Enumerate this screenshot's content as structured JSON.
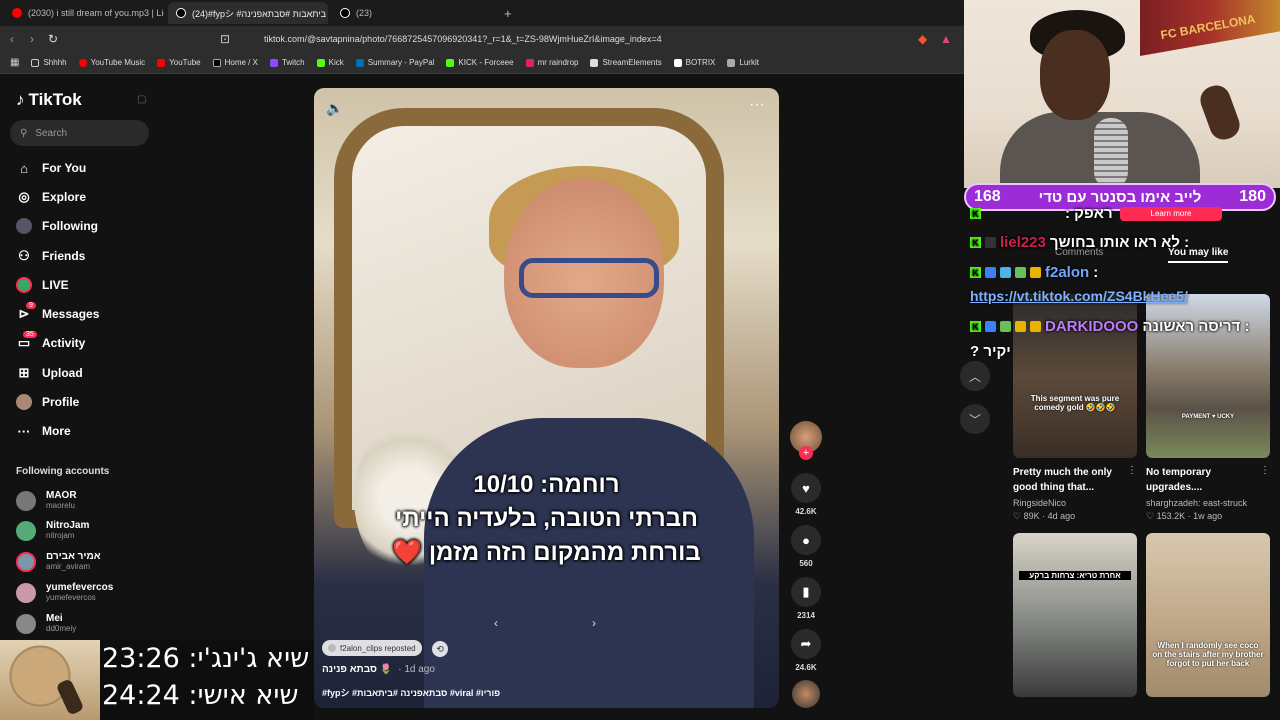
{
  "browser": {
    "tabs": [
      {
        "title": "(2030) i still dream of you.mp3 | Liqu",
        "active": false,
        "color": "#ff0000"
      },
      {
        "title": "(24)#fypシ #ביתאבות #סבתאפנינה",
        "active": true,
        "color": "#ffffff"
      },
      {
        "title": "(23)",
        "active": false,
        "color": "#ffffff"
      }
    ],
    "new_tab": "+",
    "url": "tiktok.com/@savtapnina/photo/7668725457096920341?_r=1&_t=ZS-98WjmHueZrI&image_index=4",
    "bookmarks": [
      "Shhhh",
      "YouTube Music",
      "YouTube",
      "Home / X",
      "Twitch",
      "Kick",
      "Summary - PayPal",
      "KICK - Forceee",
      "mr raindrop",
      "StreamElements",
      "BOTRIX",
      "Lurkit"
    ]
  },
  "tiktok": {
    "logo": "TikTok",
    "search_placeholder": "Search",
    "nav": [
      {
        "label": "For You",
        "icon": "home-icon"
      },
      {
        "label": "Explore",
        "icon": "compass-icon"
      },
      {
        "label": "Following",
        "icon": "following-icon"
      },
      {
        "label": "Friends",
        "icon": "friends-icon"
      },
      {
        "label": "LIVE",
        "icon": "live-icon"
      },
      {
        "label": "Messages",
        "icon": "messages-icon",
        "badge": "9"
      },
      {
        "label": "Activity",
        "icon": "activity-icon",
        "badge": "35"
      },
      {
        "label": "Upload",
        "icon": "upload-icon"
      },
      {
        "label": "Profile",
        "icon": "profile-icon"
      },
      {
        "label": "More",
        "icon": "more-icon"
      }
    ],
    "following_title": "Following accounts",
    "following_accounts": [
      {
        "name": "MAOR",
        "handle": "maorelu"
      },
      {
        "name": "NitroJam",
        "handle": "nitrojam"
      },
      {
        "name": "אמיר אבירם",
        "handle": "amir_aviram"
      },
      {
        "name": "yumefevercos",
        "handle": "yumefevercos"
      },
      {
        "name": "Mei",
        "handle": "dd0meiy"
      }
    ],
    "video": {
      "caption_lines": [
        "רוחמה: 10/10",
        "חברתי הטובה, בלעדיה הייתי",
        "בורחת מהמקום הזה מזמן ❤️"
      ],
      "repost_label": "f2alon_clips reposted",
      "author": "סבתא פנינה 🌷",
      "time_ago": "· 1d ago",
      "hashtags": "#fypシ #סבתאפנינה #ביתאבות #viral #פוריו"
    },
    "actions": {
      "likes": "42.6K",
      "comments": "560",
      "saves": "2314",
      "shares": "24.6K"
    },
    "panel_tabs": {
      "comments": "Comments",
      "you_may_like": "You may like"
    },
    "learn_more": "Learn more",
    "recommendations": [
      {
        "overlay": "This segment was pure comedy gold 🤣🤣🤣",
        "title": "Pretty much the only good thing that...",
        "author": "RingsideNico",
        "likes": "♡ 89K",
        "ago": "4d ago"
      },
      {
        "overlay": "",
        "title": "No temporary upgrades....",
        "author": "sharghzadeh: east-struck",
        "likes": "♡ 153.2K",
        "ago": "1w ago"
      },
      {
        "overlay": "אחרת טריא: צרחות ברקע",
        "title": "",
        "author": "",
        "likes": "",
        "ago": ""
      },
      {
        "overlay": "When I randomly see coco on the stairs after my brother forgot to put her back",
        "title": "",
        "author": "",
        "likes": "",
        "ago": ""
      }
    ]
  },
  "stream": {
    "goal": {
      "left": "168",
      "label": "לייב אימו בסנטר עם טדי",
      "right": "180"
    },
    "banner": "FC BARCELONA",
    "chat": [
      {
        "user": "liel223",
        "message": ": לא ראו אותו בחושך"
      },
      {
        "user": "f2alon",
        "message": ":"
      },
      {
        "user": "DARKIDOOO",
        "message": ": דריסה ראשונה"
      }
    ],
    "chat_partial": "ראפק :",
    "chat_link": "https://vt.tiktok.com/ZS4BkHee5/",
    "chat_continuation": "יקיר ?",
    "timers": [
      {
        "label": "שיא ג'ינג'י: 23:26"
      },
      {
        "label": "שיא אישי: 24:24"
      }
    ]
  }
}
